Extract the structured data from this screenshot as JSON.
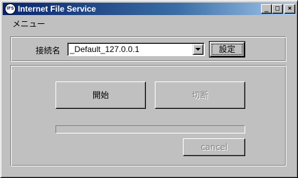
{
  "window": {
    "title": "Internet File Service",
    "icon_text": "IFS",
    "minimize_glyph": "_",
    "maximize_glyph": "□",
    "close_glyph": "×"
  },
  "menubar": {
    "menu_label": "メニュー"
  },
  "connection": {
    "label": "接続名",
    "selected_value": "_Default_127.0.0.1",
    "settings_button": "設定"
  },
  "actions": {
    "start_button": "開始",
    "disconnect_button": "切断",
    "cancel_button": "cancel"
  },
  "progress": {
    "value_percent": 0
  }
}
